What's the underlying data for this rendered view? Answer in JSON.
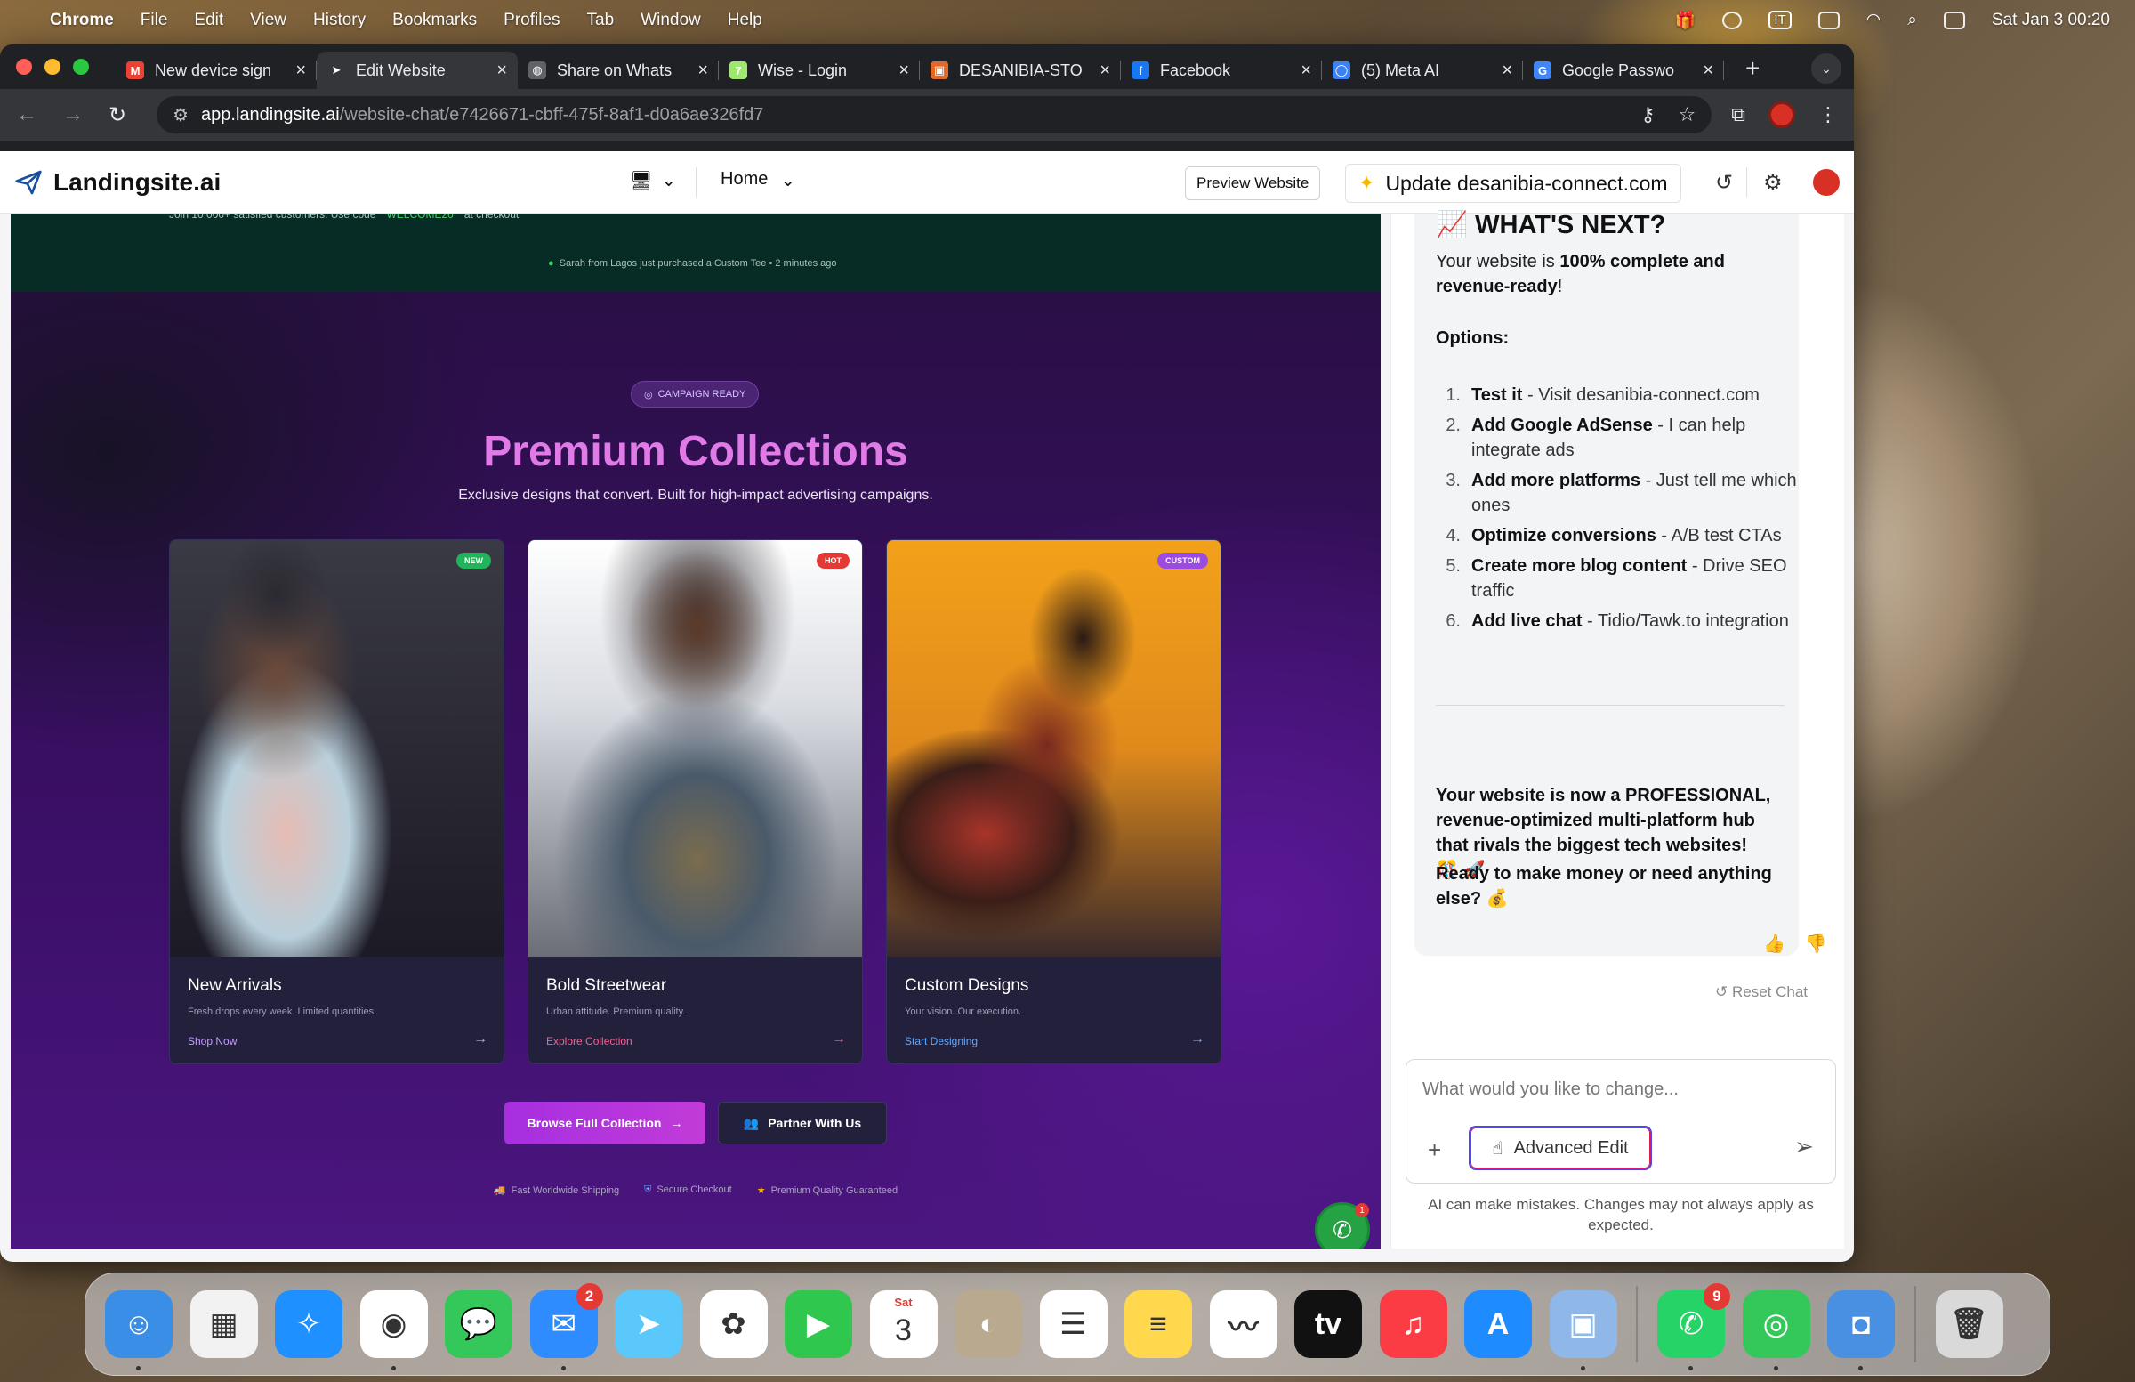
{
  "menubar": {
    "app": "Chrome",
    "items": [
      "File",
      "Edit",
      "View",
      "History",
      "Bookmarks",
      "Profiles",
      "Tab",
      "Window",
      "Help"
    ],
    "ime": "IT",
    "datetime": "Sat Jan 3  00:20"
  },
  "tabs": [
    {
      "title": "New device sign",
      "icon": "gmail-icon",
      "color": "#ea4335",
      "glyph": "M"
    },
    {
      "title": "Edit Website",
      "icon": "landingsite-icon",
      "color": "#35363a",
      "glyph": "➤",
      "active": true
    },
    {
      "title": "Share on Whats",
      "icon": "globe-icon",
      "color": "#5f6368",
      "glyph": "◍"
    },
    {
      "title": "Wise - Login",
      "icon": "wise-icon",
      "color": "#9fe870",
      "glyph": "7"
    },
    {
      "title": "DESANIBIA-STO",
      "icon": "store-icon",
      "color": "#e06a2b",
      "glyph": "▣"
    },
    {
      "title": "Facebook",
      "icon": "facebook-icon",
      "color": "#1877f2",
      "glyph": "f"
    },
    {
      "title": "(5) Meta AI",
      "icon": "meta-ai-icon",
      "color": "#3b82f6",
      "glyph": "◯"
    },
    {
      "title": "Google Passwo",
      "icon": "google-icon",
      "color": "#4285f4",
      "glyph": "G"
    }
  ],
  "url": {
    "host": "app.landingsite.ai",
    "path": "/website-chat/e7426671-cbff-475f-8af1-d0a6ae326fd7"
  },
  "app": {
    "logo": "Landingsite.ai",
    "page_select": "Home",
    "preview_label": "Preview Website",
    "update_label": "Update desanibia-connect.com"
  },
  "site": {
    "promo_text": "Join 10,000+ satisfied customers. Use code",
    "promo_code": "WELCOME20",
    "promo_suffix": "at checkout",
    "live_text": "Sarah from Lagos just purchased a Custom Tee • 2 minutes ago",
    "badge": "CAMPAIGN READY",
    "title": "Premium Collections",
    "subtitle": "Exclusive designs that convert. Built for high-impact advertising campaigns.",
    "cards": [
      {
        "tag": "NEW",
        "tag_color": "#22b45a",
        "title": "New Arrivals",
        "desc": "Fresh drops every week. Limited quantities.",
        "link": "Shop Now",
        "link_color": "#c49bff"
      },
      {
        "tag": "HOT",
        "tag_color": "#e53935",
        "title": "Bold Streetwear",
        "desc": "Urban attitude. Premium quality.",
        "link": "Explore Collection",
        "link_color": "#f06292"
      },
      {
        "tag": "CUSTOM",
        "tag_color": "#9b4be0",
        "title": "Custom Designs",
        "desc": "Your vision. Our execution.",
        "link": "Start Designing",
        "link_color": "#5ea8ff"
      }
    ],
    "cta_primary": "Browse Full Collection",
    "cta_secondary": "Partner With Us",
    "features": [
      "Fast Worldwide Shipping",
      "Secure Checkout",
      "Premium Quality Guaranteed"
    ],
    "whatsapp_badge": "1"
  },
  "chat": {
    "heading": "📈 WHAT'S NEXT?",
    "intro_pre": "Your website is ",
    "intro_bold": "100% complete and revenue-ready",
    "intro_post": "!",
    "options_label": "Options:",
    "options": [
      {
        "n": "1.",
        "bold": "Test it",
        "text": " - Visit desanibia-connect.com"
      },
      {
        "n": "2.",
        "bold": "Add Google AdSense",
        "text": " - I can help integrate ads"
      },
      {
        "n": "3.",
        "bold": "Add more platforms",
        "text": " - Just tell me which ones"
      },
      {
        "n": "4.",
        "bold": "Optimize conversions",
        "text": " - A/B test CTAs"
      },
      {
        "n": "5.",
        "bold": "Create more blog content",
        "text": " - Drive SEO traffic"
      },
      {
        "n": "6.",
        "bold": "Add live chat",
        "text": " - Tidio/Tawk.to integration"
      }
    ],
    "outro1": "Your website is now a PROFESSIONAL, revenue-optimized multi-platform hub that rivals the biggest tech websites! 🎊 🚀",
    "outro2": "Ready to make money or need anything else? 💰",
    "reset_label": "Reset Chat",
    "input_placeholder": "What would you like to change...",
    "advanced_label": "Advanced Edit",
    "disclaimer": "AI can make mistakes. Changes may not always apply as expected."
  },
  "dock": [
    {
      "name": "finder-icon",
      "color": "#3a8ee6",
      "glyph": "☺",
      "dot": true
    },
    {
      "name": "launchpad-icon",
      "color": "#f2f2f2",
      "glyph": "▦"
    },
    {
      "name": "safari-icon",
      "color": "#1e90ff",
      "glyph": "✧"
    },
    {
      "name": "chrome-icon",
      "color": "#ffffff",
      "glyph": "◉",
      "dot": true
    },
    {
      "name": "messages-icon",
      "color": "#34c759",
      "glyph": "💬"
    },
    {
      "name": "mail-icon",
      "color": "#2f8cff",
      "glyph": "✉",
      "badge": "2",
      "dot": true
    },
    {
      "name": "maps-icon",
      "color": "#5ac8fa",
      "glyph": "➤"
    },
    {
      "name": "photos-icon",
      "color": "#ffffff",
      "glyph": "✿"
    },
    {
      "name": "facetime-icon",
      "color": "#30c74e",
      "glyph": "▶"
    },
    {
      "name": "calendar-icon",
      "color": "#ffffff",
      "glyph": "3",
      "label": "Sat"
    },
    {
      "name": "contacts-icon",
      "color": "#b9a98e",
      "glyph": "◐"
    },
    {
      "name": "reminders-icon",
      "color": "#ffffff",
      "glyph": "☰"
    },
    {
      "name": "notes-icon",
      "color": "#ffd84d",
      "glyph": "≡"
    },
    {
      "name": "freeform-icon",
      "color": "#ffffff",
      "glyph": "〰"
    },
    {
      "name": "apple-tv-icon",
      "color": "#111111",
      "glyph": "tv"
    },
    {
      "name": "music-icon",
      "color": "#fc3c44",
      "glyph": "♫"
    },
    {
      "name": "app-store-icon",
      "color": "#1e8cff",
      "glyph": "A"
    },
    {
      "name": "preview-icon",
      "color": "#8fb8e8",
      "glyph": "▣",
      "dot": true
    },
    {
      "name": "whatsapp-icon",
      "color": "#25d366",
      "glyph": "✆",
      "badge": "9",
      "sep": true,
      "dot": true
    },
    {
      "name": "find-my-icon",
      "color": "#34c759",
      "glyph": "◎",
      "dot": true
    },
    {
      "name": "utility-icon",
      "color": "#4a90e2",
      "glyph": "◘",
      "dot": true
    },
    {
      "name": "trash-icon",
      "color": "#d9d9d9",
      "glyph": "🗑",
      "sep": true
    }
  ]
}
